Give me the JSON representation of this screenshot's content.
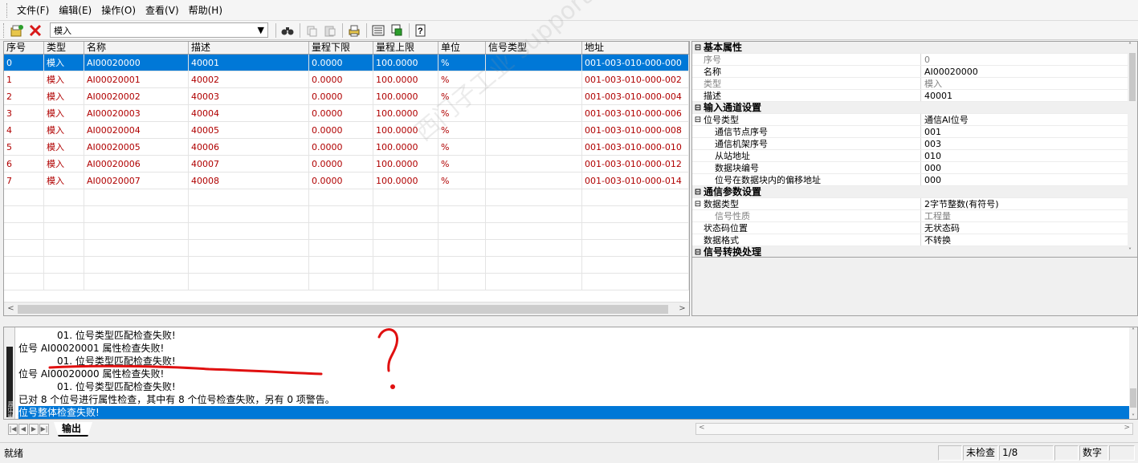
{
  "menu": [
    "文件(F)",
    "编辑(E)",
    "操作(O)",
    "查看(V)",
    "帮助(H)"
  ],
  "toolbar": {
    "combo_value": "模入",
    "icons": [
      "new-icon",
      "delete-icon",
      "find-icon",
      "copy-icon",
      "paste-icon",
      "print-icon",
      "import-icon",
      "export-icon",
      "help-icon"
    ]
  },
  "grid": {
    "headers": [
      "序号",
      "类型",
      "名称",
      "描述",
      "量程下限",
      "量程上限",
      "单位",
      "信号类型",
      "地址"
    ],
    "rows": [
      [
        "0",
        "模入",
        "AI00020000",
        "40001",
        "0.0000",
        "100.0000",
        "%",
        "",
        "001-003-010-000-000"
      ],
      [
        "1",
        "模入",
        "AI00020001",
        "40002",
        "0.0000",
        "100.0000",
        "%",
        "",
        "001-003-010-000-002"
      ],
      [
        "2",
        "模入",
        "AI00020002",
        "40003",
        "0.0000",
        "100.0000",
        "%",
        "",
        "001-003-010-000-004"
      ],
      [
        "3",
        "模入",
        "AI00020003",
        "40004",
        "0.0000",
        "100.0000",
        "%",
        "",
        "001-003-010-000-006"
      ],
      [
        "4",
        "模入",
        "AI00020004",
        "40005",
        "0.0000",
        "100.0000",
        "%",
        "",
        "001-003-010-000-008"
      ],
      [
        "5",
        "模入",
        "AI00020005",
        "40006",
        "0.0000",
        "100.0000",
        "%",
        "",
        "001-003-010-000-010"
      ],
      [
        "6",
        "模入",
        "AI00020006",
        "40007",
        "0.0000",
        "100.0000",
        "%",
        "",
        "001-003-010-000-012"
      ],
      [
        "7",
        "模入",
        "AI00020007",
        "40008",
        "0.0000",
        "100.0000",
        "%",
        "",
        "001-003-010-000-014"
      ]
    ],
    "selected_row": 0
  },
  "props": [
    {
      "type": "sec",
      "key": "基本属性"
    },
    {
      "type": "gray",
      "key": "序号",
      "val": "0"
    },
    {
      "type": "normal",
      "key": "名称",
      "val": "AI00020000"
    },
    {
      "type": "gray",
      "key": "类型",
      "val": "模入"
    },
    {
      "type": "normal",
      "key": "描述",
      "val": "40001"
    },
    {
      "type": "sec",
      "key": "输入通道设置"
    },
    {
      "type": "group",
      "key": "位号类型",
      "val": "通信AI位号"
    },
    {
      "type": "sub",
      "key": "通信节点序号",
      "val": "001"
    },
    {
      "type": "sub",
      "key": "通信机架序号",
      "val": "003"
    },
    {
      "type": "sub",
      "key": "从站地址",
      "val": "010"
    },
    {
      "type": "sub",
      "key": "数据块编号",
      "val": "000"
    },
    {
      "type": "sub",
      "key": "位号在数据块内的偏移地址",
      "val": "000"
    },
    {
      "type": "sec",
      "key": "通信参数设置"
    },
    {
      "type": "group",
      "key": "数据类型",
      "val": "2字节整数(有符号)"
    },
    {
      "type": "subgray",
      "key": "信号性质",
      "val": "工程量"
    },
    {
      "type": "normal",
      "key": "状态码位置",
      "val": "无状态码"
    },
    {
      "type": "normal",
      "key": "数据格式",
      "val": "不转换"
    },
    {
      "type": "sec",
      "key": "信号转换处理"
    }
  ],
  "output": {
    "lines": [
      {
        "text": "01. 位号类型匹配检查失败!",
        "indent": true
      },
      {
        "text": "位号 AI00020001 属性检查失败!",
        "indent": false
      },
      {
        "text": "01. 位号类型匹配检查失败!",
        "indent": true
      },
      {
        "text": "位号 AI00020000 属性检查失败!",
        "indent": false
      },
      {
        "text": "01. 位号类型匹配检查失败!",
        "indent": true
      },
      {
        "text": "已对 8 个位号进行属性检查，其中有 8 个位号检查失败，另有 0 项警告。",
        "indent": false
      },
      {
        "text": "位号整体检查失败!",
        "indent": false,
        "highlight": true
      }
    ],
    "side_label": "输出窗口",
    "tab_label": "输出"
  },
  "status": {
    "left": "就绪",
    "check": "未检查",
    "count": "1/8",
    "num": "数字"
  },
  "watermark": "西门子工业 support.industry.siemens.com",
  "colors": {
    "selection": "#0078d7",
    "row_text": "#b00000",
    "annotation": "#e01010"
  }
}
